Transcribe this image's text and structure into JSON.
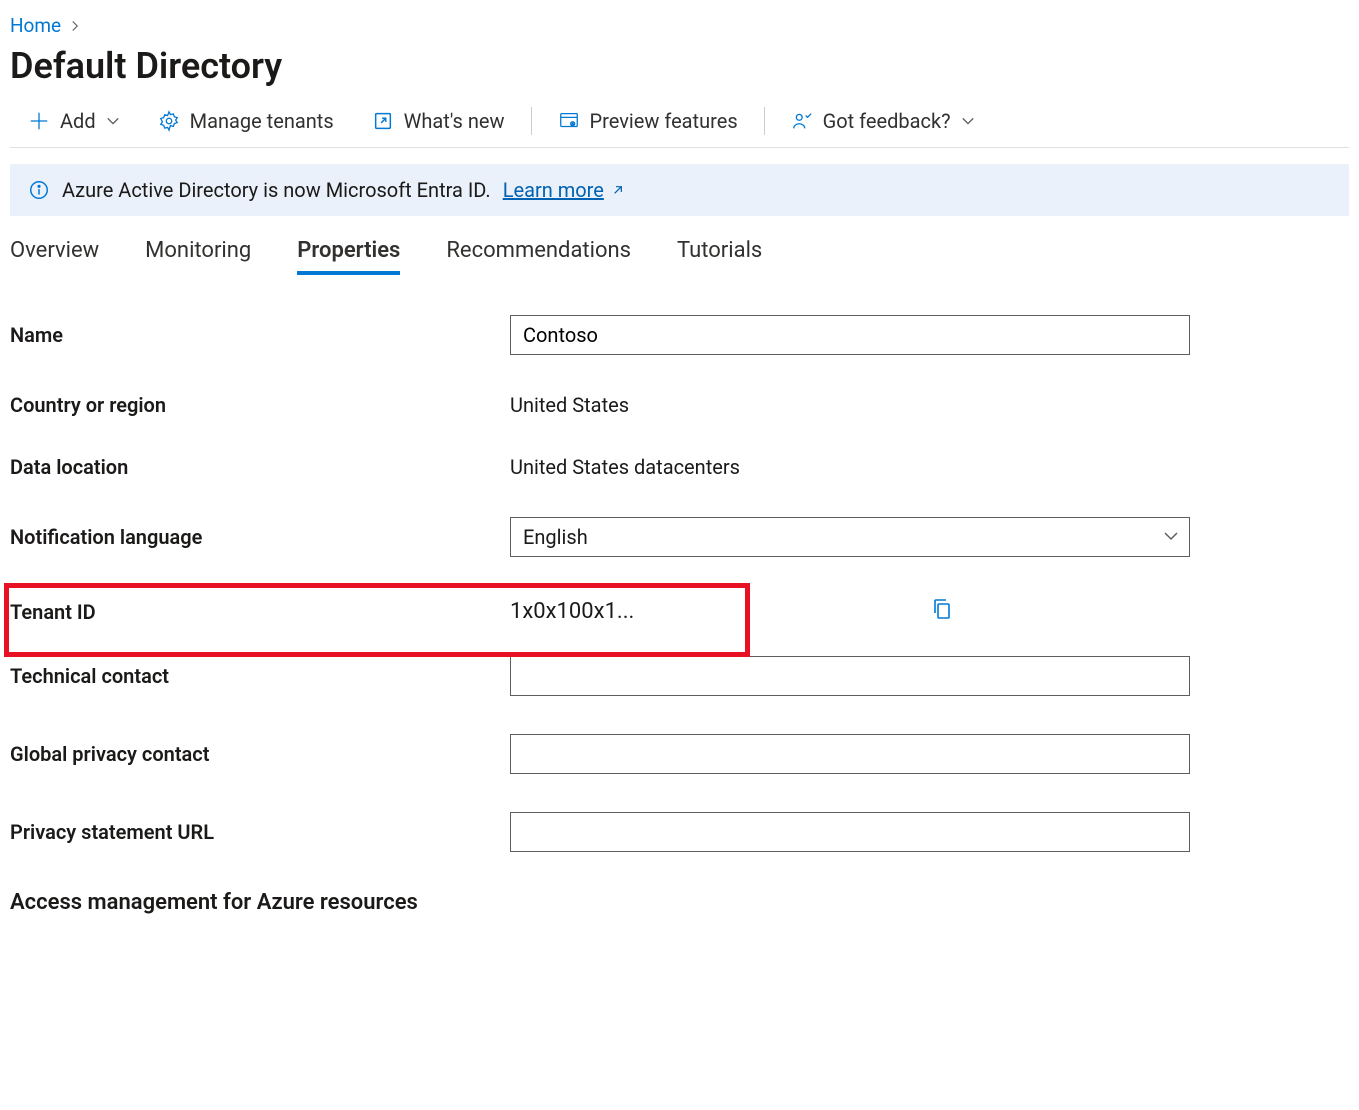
{
  "breadcrumb": {
    "home": "Home"
  },
  "page_title": "Default Directory",
  "toolbar": {
    "add": "Add",
    "manage_tenants": "Manage tenants",
    "whats_new": "What's new",
    "preview_features": "Preview features",
    "got_feedback": "Got feedback?"
  },
  "banner": {
    "text": "Azure Active Directory is now Microsoft Entra ID.",
    "link": "Learn more"
  },
  "tabs": {
    "overview": "Overview",
    "monitoring": "Monitoring",
    "properties": "Properties",
    "recommendations": "Recommendations",
    "tutorials": "Tutorials"
  },
  "form": {
    "name_label": "Name",
    "name_value": "Contoso",
    "country_label": "Country or region",
    "country_value": "United States",
    "data_location_label": "Data location",
    "data_location_value": "United States datacenters",
    "notification_language_label": "Notification language",
    "notification_language_value": "English",
    "tenant_id_label": "Tenant ID",
    "tenant_id_value": "1x0x100x1...",
    "technical_contact_label": "Technical contact",
    "technical_contact_value": "",
    "global_privacy_label": "Global privacy contact",
    "global_privacy_value": "",
    "privacy_url_label": "Privacy statement URL",
    "privacy_url_value": ""
  },
  "section_heading": "Access management for Azure resources"
}
